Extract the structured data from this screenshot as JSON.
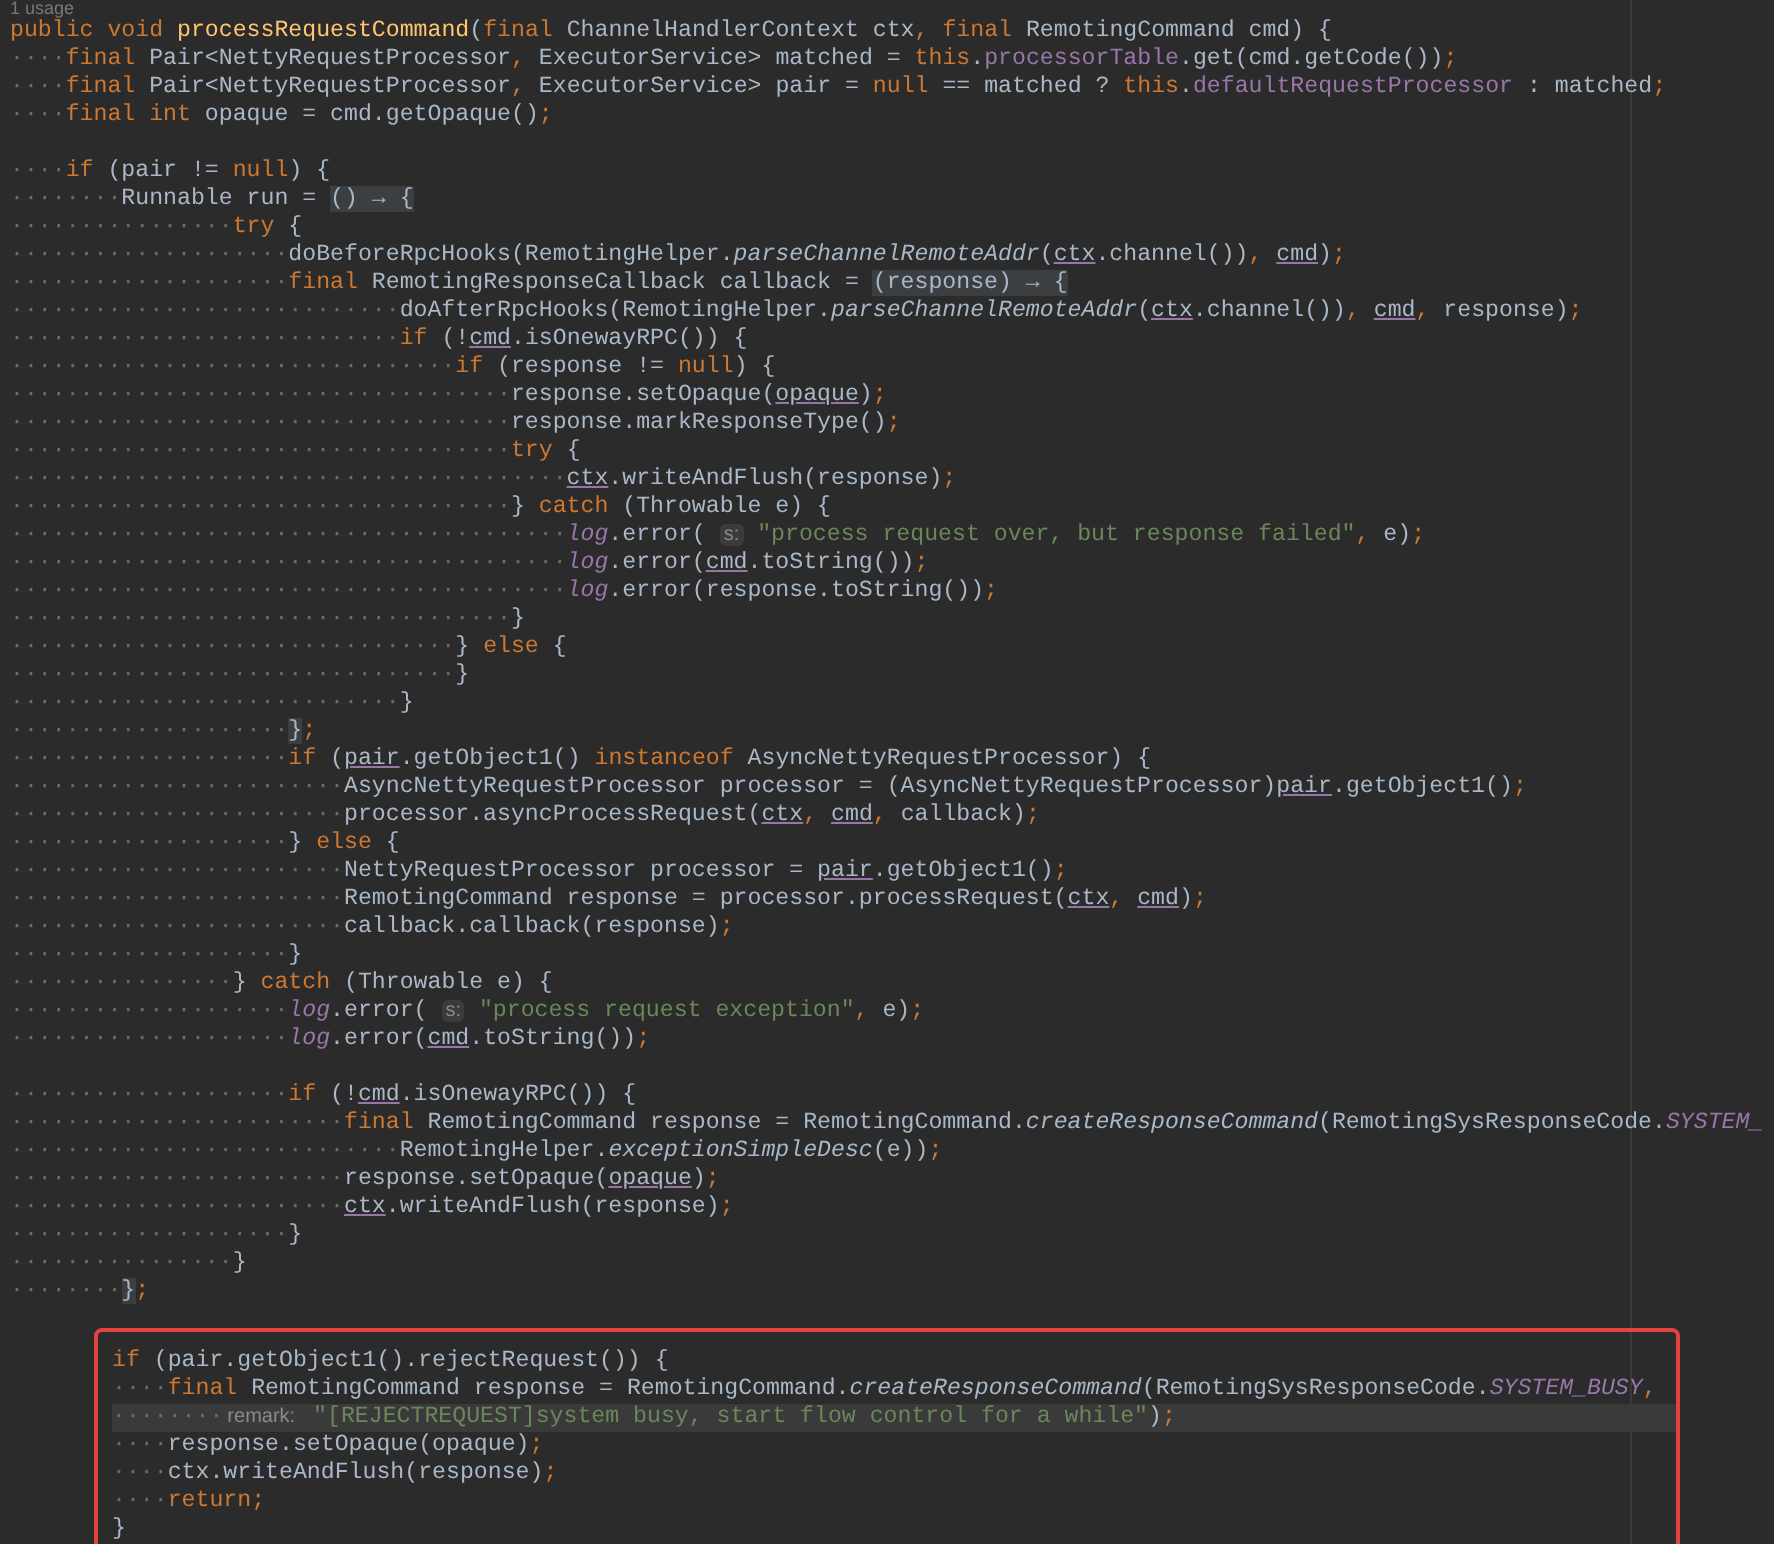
{
  "usage_hint": "1 usage",
  "code_lines": [
    {
      "kind": "code",
      "tokens": [
        {
          "kind": "keyword",
          "text": "public void "
        },
        {
          "kind": "method_decl",
          "text": "processRequestCommand"
        },
        {
          "kind": "plain",
          "text": "("
        },
        {
          "kind": "keyword",
          "text": "final "
        },
        {
          "kind": "plain",
          "text": "ChannelHandlerContext ctx, "
        },
        {
          "kind": "keyword",
          "text": "final "
        },
        {
          "kind": "plain",
          "text": "RemotingCommand cmd) {"
        }
      ]
    },
    {
      "kind": "code",
      "indent": "····",
      "tokens": [
        {
          "kind": "keyword",
          "text": "final "
        },
        {
          "kind": "plain",
          "text": "Pair<NettyRequestProcessor, ExecutorService> matched = "
        },
        {
          "kind": "keyword",
          "text": "this"
        },
        {
          "kind": "plain",
          "text": "."
        },
        {
          "kind": "field",
          "text": "processorTable"
        },
        {
          "kind": "plain",
          "text": ".get(cmd.getCode());"
        }
      ]
    },
    {
      "kind": "code",
      "indent": "····",
      "tokens": [
        {
          "kind": "keyword",
          "text": "final "
        },
        {
          "kind": "plain",
          "text": "Pair<NettyRequestProcessor, ExecutorService> pair = "
        },
        {
          "kind": "keyword",
          "text": "null "
        },
        {
          "kind": "plain",
          "text": "== matched ? "
        },
        {
          "kind": "keyword",
          "text": "this"
        },
        {
          "kind": "plain",
          "text": "."
        },
        {
          "kind": "field",
          "text": "defaultRequestProcessor"
        },
        {
          "kind": "plain",
          "text": " : matched;"
        }
      ]
    },
    {
      "kind": "code",
      "indent": "····",
      "tokens": [
        {
          "kind": "keyword",
          "text": "final int "
        },
        {
          "kind": "plain",
          "text": "opaque = cmd.getOpaque();"
        }
      ]
    },
    {
      "kind": "blank"
    },
    {
      "kind": "code",
      "indent": "····",
      "tokens": [
        {
          "kind": "keyword",
          "text": "if "
        },
        {
          "kind": "plain",
          "text": "(pair != "
        },
        {
          "kind": "keyword",
          "text": "null"
        },
        {
          "kind": "plain",
          "text": ") {"
        }
      ]
    },
    {
      "kind": "code",
      "indent": "········",
      "tokens": [
        {
          "kind": "plain",
          "text": "Runnable run = "
        },
        {
          "kind": "fold",
          "text": "() → {"
        }
      ]
    },
    {
      "kind": "code",
      "indent": "················",
      "tokens": [
        {
          "kind": "keyword",
          "text": "try "
        },
        {
          "kind": "plain",
          "text": "{"
        }
      ]
    },
    {
      "kind": "code",
      "indent": "····················",
      "tokens": [
        {
          "kind": "plain",
          "text": "doBeforeRpcHooks(RemotingHelper."
        },
        {
          "kind": "static_method",
          "text": "parseChannelRemoteAddr"
        },
        {
          "kind": "plain",
          "text": "("
        },
        {
          "kind": "captured",
          "text": "ctx"
        },
        {
          "kind": "plain",
          "text": ".channel()), "
        },
        {
          "kind": "captured",
          "text": "cmd"
        },
        {
          "kind": "plain",
          "text": ");"
        }
      ]
    },
    {
      "kind": "code",
      "indent": "····················",
      "tokens": [
        {
          "kind": "keyword",
          "text": "final "
        },
        {
          "kind": "plain",
          "text": "RemotingResponseCallback callback = "
        },
        {
          "kind": "fold",
          "text": "(response) → {"
        }
      ]
    },
    {
      "kind": "code",
      "indent": "····························",
      "tokens": [
        {
          "kind": "plain",
          "text": "doAfterRpcHooks(RemotingHelper."
        },
        {
          "kind": "static_method",
          "text": "parseChannelRemoteAddr"
        },
        {
          "kind": "plain",
          "text": "("
        },
        {
          "kind": "captured",
          "text": "ctx"
        },
        {
          "kind": "plain",
          "text": ".channel()), "
        },
        {
          "kind": "captured",
          "text": "cmd"
        },
        {
          "kind": "plain",
          "text": ", response);"
        }
      ]
    },
    {
      "kind": "code",
      "indent": "····························",
      "tokens": [
        {
          "kind": "keyword",
          "text": "if "
        },
        {
          "kind": "plain",
          "text": "(!"
        },
        {
          "kind": "captured",
          "text": "cmd"
        },
        {
          "kind": "plain",
          "text": ".isOnewayRPC()) {"
        }
      ]
    },
    {
      "kind": "code",
      "indent": "································",
      "tokens": [
        {
          "kind": "keyword",
          "text": "if "
        },
        {
          "kind": "plain",
          "text": "(response != "
        },
        {
          "kind": "keyword",
          "text": "null"
        },
        {
          "kind": "plain",
          "text": ") {"
        }
      ]
    },
    {
      "kind": "code",
      "indent": "····································",
      "tokens": [
        {
          "kind": "plain",
          "text": "response.setOpaque("
        },
        {
          "kind": "captured",
          "text": "opaque"
        },
        {
          "kind": "plain",
          "text": ");"
        }
      ]
    },
    {
      "kind": "code",
      "indent": "····································",
      "tokens": [
        {
          "kind": "plain",
          "text": "response.markResponseType();"
        }
      ]
    },
    {
      "kind": "code",
      "indent": "····································",
      "tokens": [
        {
          "kind": "keyword",
          "text": "try "
        },
        {
          "kind": "plain",
          "text": "{"
        }
      ]
    },
    {
      "kind": "code",
      "indent": "········································",
      "tokens": [
        {
          "kind": "captured",
          "text": "ctx"
        },
        {
          "kind": "plain",
          "text": ".writeAndFlush(response);"
        }
      ]
    },
    {
      "kind": "code",
      "indent": "····································",
      "tokens": [
        {
          "kind": "plain",
          "text": "} "
        },
        {
          "kind": "keyword",
          "text": "catch "
        },
        {
          "kind": "plain",
          "text": "(Throwable e) {"
        }
      ]
    },
    {
      "kind": "code",
      "indent": "········································",
      "tokens": [
        {
          "kind": "static_field",
          "text": "log"
        },
        {
          "kind": "plain",
          "text": ".error( "
        },
        {
          "kind": "hint",
          "text": "s:"
        },
        {
          "kind": "string",
          "text": " \"process request over, but response failed\""
        },
        {
          "kind": "plain",
          "text": ", e);"
        }
      ]
    },
    {
      "kind": "code",
      "indent": "········································",
      "tokens": [
        {
          "kind": "static_field",
          "text": "log"
        },
        {
          "kind": "plain",
          "text": ".error("
        },
        {
          "kind": "captured",
          "text": "cmd"
        },
        {
          "kind": "plain",
          "text": ".toString());"
        }
      ]
    },
    {
      "kind": "code",
      "indent": "········································",
      "tokens": [
        {
          "kind": "static_field",
          "text": "log"
        },
        {
          "kind": "plain",
          "text": ".error(response.toString());"
        }
      ]
    },
    {
      "kind": "code",
      "indent": "····································",
      "tokens": [
        {
          "kind": "plain",
          "text": "}"
        }
      ]
    },
    {
      "kind": "code",
      "indent": "································",
      "tokens": [
        {
          "kind": "plain",
          "text": "} "
        },
        {
          "kind": "keyword",
          "text": "else "
        },
        {
          "kind": "plain",
          "text": "{"
        }
      ]
    },
    {
      "kind": "code",
      "indent": "································",
      "tokens": [
        {
          "kind": "plain",
          "text": "}"
        }
      ]
    },
    {
      "kind": "code",
      "indent": "····························",
      "tokens": [
        {
          "kind": "plain",
          "text": "}"
        }
      ]
    },
    {
      "kind": "code",
      "indent": "····················",
      "tokens": [
        {
          "kind": "fold",
          "text": "}"
        },
        {
          "kind": "plain",
          "text": ";"
        }
      ]
    },
    {
      "kind": "code",
      "indent": "····················",
      "tokens": [
        {
          "kind": "keyword",
          "text": "if "
        },
        {
          "kind": "plain",
          "text": "("
        },
        {
          "kind": "captured",
          "text": "pair"
        },
        {
          "kind": "plain",
          "text": ".getObject1() "
        },
        {
          "kind": "keyword",
          "text": "instanceof "
        },
        {
          "kind": "plain",
          "text": "AsyncNettyRequestProcessor) {"
        }
      ]
    },
    {
      "kind": "code",
      "indent": "························",
      "tokens": [
        {
          "kind": "plain",
          "text": "AsyncNettyRequestProcessor processor = (AsyncNettyRequestProcessor)"
        },
        {
          "kind": "captured",
          "text": "pair"
        },
        {
          "kind": "plain",
          "text": ".getObject1();"
        }
      ]
    },
    {
      "kind": "code",
      "indent": "························",
      "tokens": [
        {
          "kind": "plain",
          "text": "processor.asyncProcessRequest("
        },
        {
          "kind": "captured",
          "text": "ctx"
        },
        {
          "kind": "plain",
          "text": ", "
        },
        {
          "kind": "captured",
          "text": "cmd"
        },
        {
          "kind": "plain",
          "text": ", callback);"
        }
      ]
    },
    {
      "kind": "code",
      "indent": "····················",
      "tokens": [
        {
          "kind": "plain",
          "text": "} "
        },
        {
          "kind": "keyword",
          "text": "else "
        },
        {
          "kind": "plain",
          "text": "{"
        }
      ]
    },
    {
      "kind": "code",
      "indent": "························",
      "tokens": [
        {
          "kind": "plain",
          "text": "NettyRequestProcessor processor = "
        },
        {
          "kind": "captured",
          "text": "pair"
        },
        {
          "kind": "plain",
          "text": ".getObject1();"
        }
      ]
    },
    {
      "kind": "code",
      "indent": "························",
      "tokens": [
        {
          "kind": "plain",
          "text": "RemotingCommand response = processor.processRequest("
        },
        {
          "kind": "captured",
          "text": "ctx"
        },
        {
          "kind": "plain",
          "text": ", "
        },
        {
          "kind": "captured",
          "text": "cmd"
        },
        {
          "kind": "plain",
          "text": ");"
        }
      ]
    },
    {
      "kind": "code",
      "indent": "························",
      "tokens": [
        {
          "kind": "plain",
          "text": "callback.callback(response);"
        }
      ]
    },
    {
      "kind": "code",
      "indent": "····················",
      "tokens": [
        {
          "kind": "plain",
          "text": "}"
        }
      ]
    },
    {
      "kind": "code",
      "indent": "················",
      "tokens": [
        {
          "kind": "plain",
          "text": "} "
        },
        {
          "kind": "keyword",
          "text": "catch "
        },
        {
          "kind": "plain",
          "text": "(Throwable e) {"
        }
      ]
    },
    {
      "kind": "code",
      "indent": "····················",
      "tokens": [
        {
          "kind": "static_field",
          "text": "log"
        },
        {
          "kind": "plain",
          "text": ".error( "
        },
        {
          "kind": "hint",
          "text": "s:"
        },
        {
          "kind": "string",
          "text": " \"process request exception\""
        },
        {
          "kind": "plain",
          "text": ", e);"
        }
      ]
    },
    {
      "kind": "code",
      "indent": "····················",
      "tokens": [
        {
          "kind": "static_field",
          "text": "log"
        },
        {
          "kind": "plain",
          "text": ".error("
        },
        {
          "kind": "captured",
          "text": "cmd"
        },
        {
          "kind": "plain",
          "text": ".toString());"
        }
      ]
    },
    {
      "kind": "blank"
    },
    {
      "kind": "code",
      "indent": "····················",
      "tokens": [
        {
          "kind": "keyword",
          "text": "if "
        },
        {
          "kind": "plain",
          "text": "(!"
        },
        {
          "kind": "captured",
          "text": "cmd"
        },
        {
          "kind": "plain",
          "text": ".isOnewayRPC()) {"
        }
      ]
    },
    {
      "kind": "code",
      "indent": "························",
      "tokens": [
        {
          "kind": "keyword",
          "text": "final "
        },
        {
          "kind": "plain",
          "text": "RemotingCommand response = RemotingCommand."
        },
        {
          "kind": "static_method",
          "text": "createResponseCommand"
        },
        {
          "kind": "plain",
          "text": "(RemotingSysResponseCode."
        },
        {
          "kind": "static_field",
          "text": "SYSTEM_"
        }
      ]
    },
    {
      "kind": "code",
      "indent": "····························",
      "tokens": [
        {
          "kind": "plain",
          "text": "RemotingHelper."
        },
        {
          "kind": "static_method",
          "text": "exceptionSimpleDesc"
        },
        {
          "kind": "plain",
          "text": "(e));"
        }
      ]
    },
    {
      "kind": "code",
      "indent": "························",
      "tokens": [
        {
          "kind": "plain",
          "text": "response.setOpaque("
        },
        {
          "kind": "captured",
          "text": "opaque"
        },
        {
          "kind": "plain",
          "text": ");"
        }
      ]
    },
    {
      "kind": "code",
      "indent": "························",
      "tokens": [
        {
          "kind": "captured",
          "text": "ctx"
        },
        {
          "kind": "plain",
          "text": ".writeAndFlush(response);"
        }
      ]
    },
    {
      "kind": "code",
      "indent": "····················",
      "tokens": [
        {
          "kind": "plain",
          "text": "}"
        }
      ]
    },
    {
      "kind": "code",
      "indent": "················",
      "tokens": [
        {
          "kind": "plain",
          "text": "}"
        }
      ]
    },
    {
      "kind": "code",
      "indent": "········",
      "tokens": [
        {
          "kind": "fold",
          "text": "}"
        },
        {
          "kind": "plain",
          "text": ";"
        }
      ]
    },
    {
      "kind": "blank"
    }
  ],
  "highlight_block": {
    "lines": [
      {
        "kind": "code",
        "current": false,
        "tokens": [
          {
            "kind": "keyword",
            "text": "if "
          },
          {
            "kind": "plain",
            "text": "(pair.getObject1().rejectRequest()) {"
          }
        ]
      },
      {
        "kind": "code",
        "current": false,
        "indent": "····",
        "tokens": [
          {
            "kind": "keyword",
            "text": "final "
          },
          {
            "kind": "plain",
            "text": "RemotingCommand response = RemotingCommand."
          },
          {
            "kind": "static_method",
            "text": "createResponseCommand"
          },
          {
            "kind": "plain",
            "text": "(RemotingSysResponseCode."
          },
          {
            "kind": "static_field",
            "text": "SYSTEM_BUSY"
          },
          {
            "kind": "plain",
            "text": ","
          }
        ]
      },
      {
        "kind": "code",
        "current": true,
        "indent": "········",
        "tokens": [
          {
            "kind": "hint",
            "text": "remark:"
          },
          {
            "kind": "string",
            "text": " \"[REJECTREQUEST]system busy, start flow control for a while\""
          },
          {
            "kind": "plain",
            "text": ");"
          }
        ]
      },
      {
        "kind": "code",
        "current": false,
        "indent": "····",
        "tokens": [
          {
            "kind": "plain",
            "text": "response.setOpaque(opaque);"
          }
        ]
      },
      {
        "kind": "code",
        "current": false,
        "indent": "····",
        "tokens": [
          {
            "kind": "plain",
            "text": "ctx.writeAndFlush(response);"
          }
        ]
      },
      {
        "kind": "code",
        "current": false,
        "indent": "····",
        "tokens": [
          {
            "kind": "keyword",
            "text": "return"
          },
          {
            "kind": "plain",
            "text": ";"
          }
        ]
      },
      {
        "kind": "code",
        "current": false,
        "tokens": [
          {
            "kind": "plain",
            "text": "}"
          }
        ]
      }
    ]
  }
}
